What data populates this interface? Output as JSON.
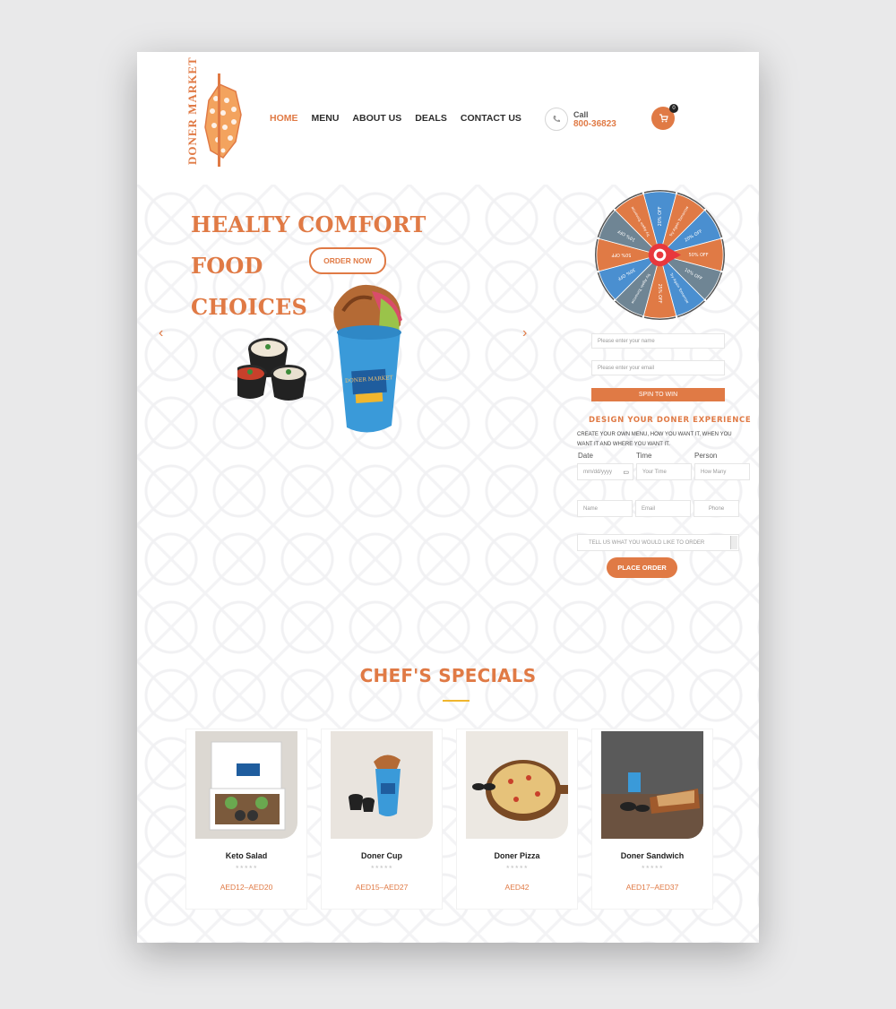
{
  "brand": {
    "logo_text": "DONER MARKET",
    "accent": "#e07a45",
    "accent_yellow": "#f0b62e"
  },
  "nav": {
    "items": [
      {
        "label": "HOME",
        "active": true
      },
      {
        "label": "MENU"
      },
      {
        "label": "ABOUT US"
      },
      {
        "label": "DEALS"
      },
      {
        "label": "CONTACT US"
      }
    ]
  },
  "call": {
    "label": "Call",
    "number": "800-36823",
    "icon": "phone-icon"
  },
  "cart": {
    "icon": "cart-icon",
    "count": "0"
  },
  "hero": {
    "title": "HEALTY COMFORT FOOD CHOICES",
    "title_line1": "HEALTY COMFORT FOOD",
    "title_line2": "CHOICES",
    "cta": "ORDER NOW",
    "prev_icon": "chevron-left-icon",
    "next_icon": "chevron-right-icon"
  },
  "wheel": {
    "segments": [
      "20% OFF",
      "Try Again Tomorrow",
      "20% OFF",
      "50% OFF",
      "10% OFF",
      "Try Again Tomorrow",
      "25% OFF",
      "Try Again Tomorrow",
      "30% OFF",
      "50% OFF",
      "10% OFF",
      "Try Again Tomorrow"
    ],
    "name_placeholder": "Please enter your name",
    "email_placeholder": "Please enter your email",
    "spin_label": "SPIN TO WIN",
    "colors": [
      "#4a8fd0",
      "#e07a45",
      "#6f8594"
    ]
  },
  "design": {
    "title": "DESIGN YOUR DONER EXPERIENCE",
    "description": "CREATE YOUR OWN MENU, HOW YOU WANT IT, WHEN YOU WANT IT AND WHERE YOU WANT IT.",
    "labels": {
      "date": "Date",
      "time": "Time",
      "person": "Person"
    },
    "placeholders": {
      "date": "mm/dd/yyyy",
      "time": "Your Time",
      "how_many": "How Many",
      "name": "Name",
      "email": "Email",
      "phone": "Phone",
      "message": "TELL US WHAT YOU WOULD LIKE TO ORDER"
    },
    "submit": "PLACE ORDER"
  },
  "specials": {
    "title": "CHEF'S SPECIALS",
    "items": [
      {
        "name": "Keto Salad",
        "price": "AED12–AED20",
        "stars": "★★★★★"
      },
      {
        "name": "Doner Cup",
        "price": "AED15–AED27",
        "stars": "★★★★★"
      },
      {
        "name": "Doner Pizza",
        "price": "AED42",
        "stars": "★★★★★"
      },
      {
        "name": "Doner Sandwich",
        "price": "AED17–AED37",
        "stars": "★★★★★"
      }
    ]
  }
}
